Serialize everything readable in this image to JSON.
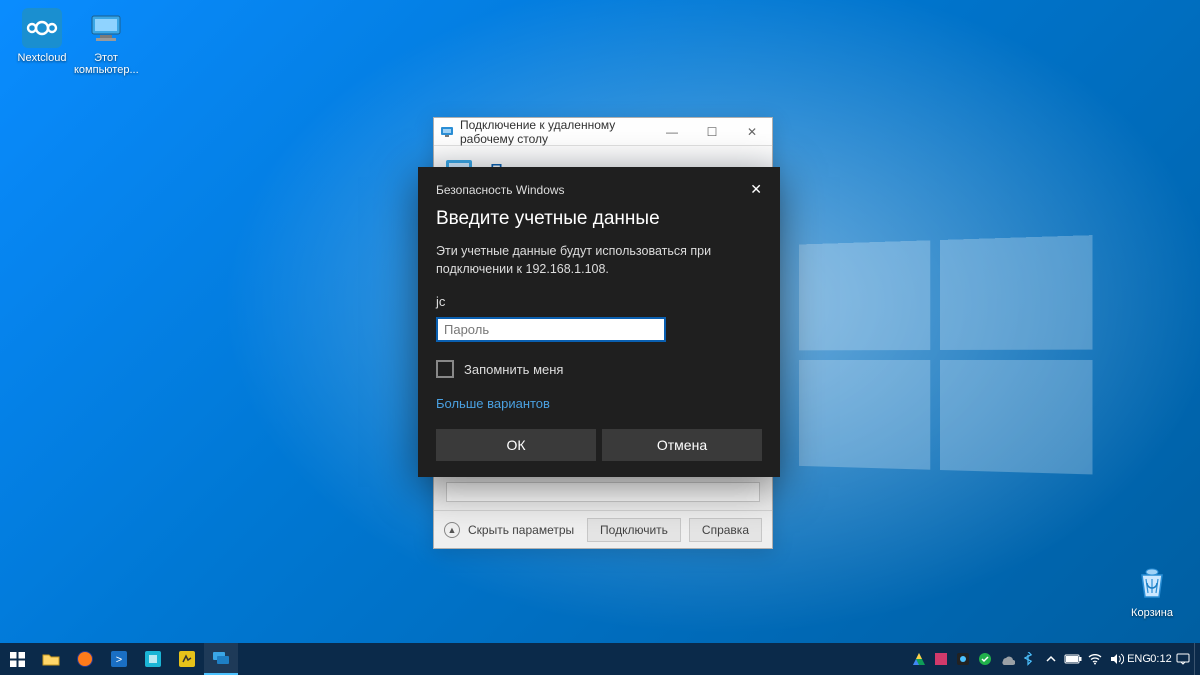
{
  "desktop": {
    "icons": {
      "nextcloud": "Nextcloud",
      "thispc": "Этот компьютер...",
      "bin": "Корзина"
    }
  },
  "rdp": {
    "title": "Подключение к удаленному рабочему столу",
    "banner": "Подключение к удаленному",
    "hide_params": "Скрыть параметры",
    "connect": "Подключить",
    "help": "Справка"
  },
  "cred": {
    "header": "Безопасность Windows",
    "title": "Введите учетные данные",
    "desc": "Эти учетные данные будут использоваться при подключении к 192.168.1.108.",
    "username": "jc",
    "password_placeholder": "Пароль",
    "remember": "Запомнить меня",
    "more": "Больше вариантов",
    "ok": "ОК",
    "cancel": "Отмена"
  },
  "taskbar": {
    "lang": "ENG",
    "time": "0:12"
  }
}
